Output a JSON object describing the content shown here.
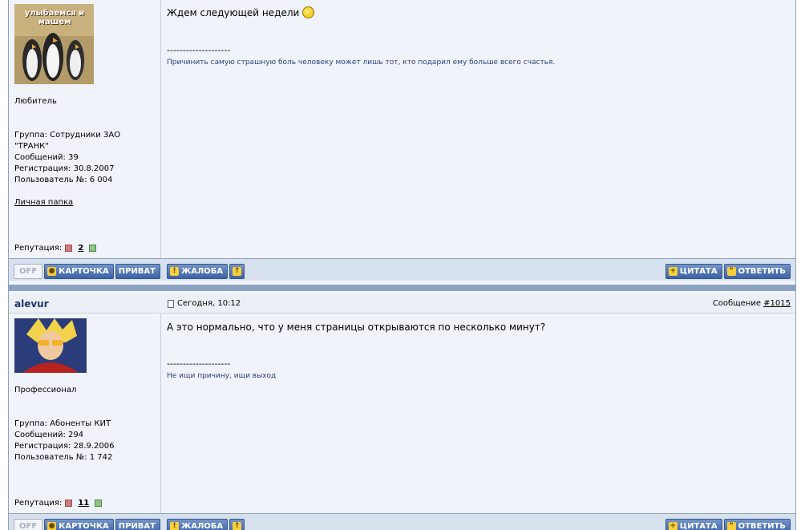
{
  "post1": {
    "rank": "Любитель",
    "group": "Группа: Сотрудники ЗАО \"ТРАНК\"",
    "posts": "Сообщений: 39",
    "registered": "Регистрация: 30.8.2007",
    "user_no": "Пользователь №: 6 004",
    "folder_link": "Личная папка",
    "reputation_label": "Репутация:",
    "reputation_value": "2",
    "avatar_caption": "улыбаемся и машем",
    "message": "Ждем следующей недели",
    "signature_line": "--------------------",
    "signature": "Причинить самую страшную боль человеку может лишь тот, кто подарил ему больше всего счастья."
  },
  "post2": {
    "author": "alevur",
    "date": "Сегодня, 10:12",
    "msg_label": "Сообщение",
    "msg_link": "#1015",
    "rank": "Профессионал",
    "group": "Группа: Абоненты КИТ",
    "posts": "Сообщений: 294",
    "registered": "Регистрация: 28.9.2006",
    "user_no": "Пользователь №: 1 742",
    "reputation_label": "Репутация:",
    "reputation_value": "11",
    "message": "А это нормально, что у меня страницы открываются по несколько минут?",
    "signature_line": "--------------------",
    "signature": "Не ищи причину, ищи выход"
  },
  "buttons": {
    "off": "OFF",
    "card": "КАРТОЧКА",
    "private": "ПРИВАТ",
    "report": "ЖАЛОБА",
    "quote": "ЦИТАТА",
    "reply": "ОТВЕТИТЬ"
  },
  "colors": {
    "frame_border": "#8ca2c3",
    "button_blue": "#3d63a4",
    "background": "#f0f3f9"
  }
}
